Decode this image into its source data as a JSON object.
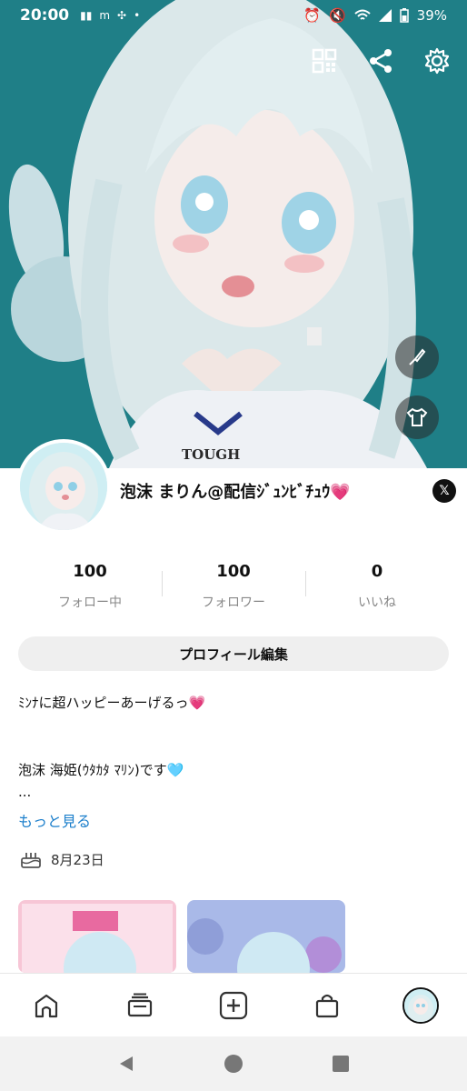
{
  "status_bar": {
    "time": "20:00",
    "battery": "39%",
    "icons": [
      "notification-icon",
      "m-icon",
      "fan-icon",
      "dot-icon",
      "alarm-icon",
      "mute-icon",
      "wifi-icon",
      "signal-icon",
      "battery-icon"
    ]
  },
  "header": {
    "background_color": "#1f7f87",
    "print_text": "TOUGH",
    "actions": [
      "qr-code-icon",
      "share-icon",
      "settings-icon"
    ],
    "side_actions": [
      "brush-icon",
      "tshirt-icon"
    ]
  },
  "profile": {
    "name": "泡沫 まりん@配信ｼﾞｭﾝﾋﾞﾁｭｳ",
    "social": "𝕏"
  },
  "stats": [
    {
      "value": "100",
      "label": "フォロー中"
    },
    {
      "value": "100",
      "label": "フォロワー"
    },
    {
      "value": "0",
      "label": "いいね"
    }
  ],
  "edit_button": "プロフィール編集",
  "bio": {
    "line1": "ﾐﾝﾅに超ハッピーあーげるっ",
    "line1_emoji": "💗",
    "line2": "泡沫 海姫(ｳﾀｶﾀ ﾏﾘﾝ)です",
    "line2_emoji": "🩵",
    "line3": "...",
    "more": "もっと見る"
  },
  "birthday": "8月23日",
  "bottom_nav": [
    "home-icon",
    "feed-icon",
    "add-icon",
    "shop-icon",
    "profile-avatar"
  ],
  "colors": {
    "accent": "#1a7ecb",
    "heart": "#e83bd9"
  }
}
